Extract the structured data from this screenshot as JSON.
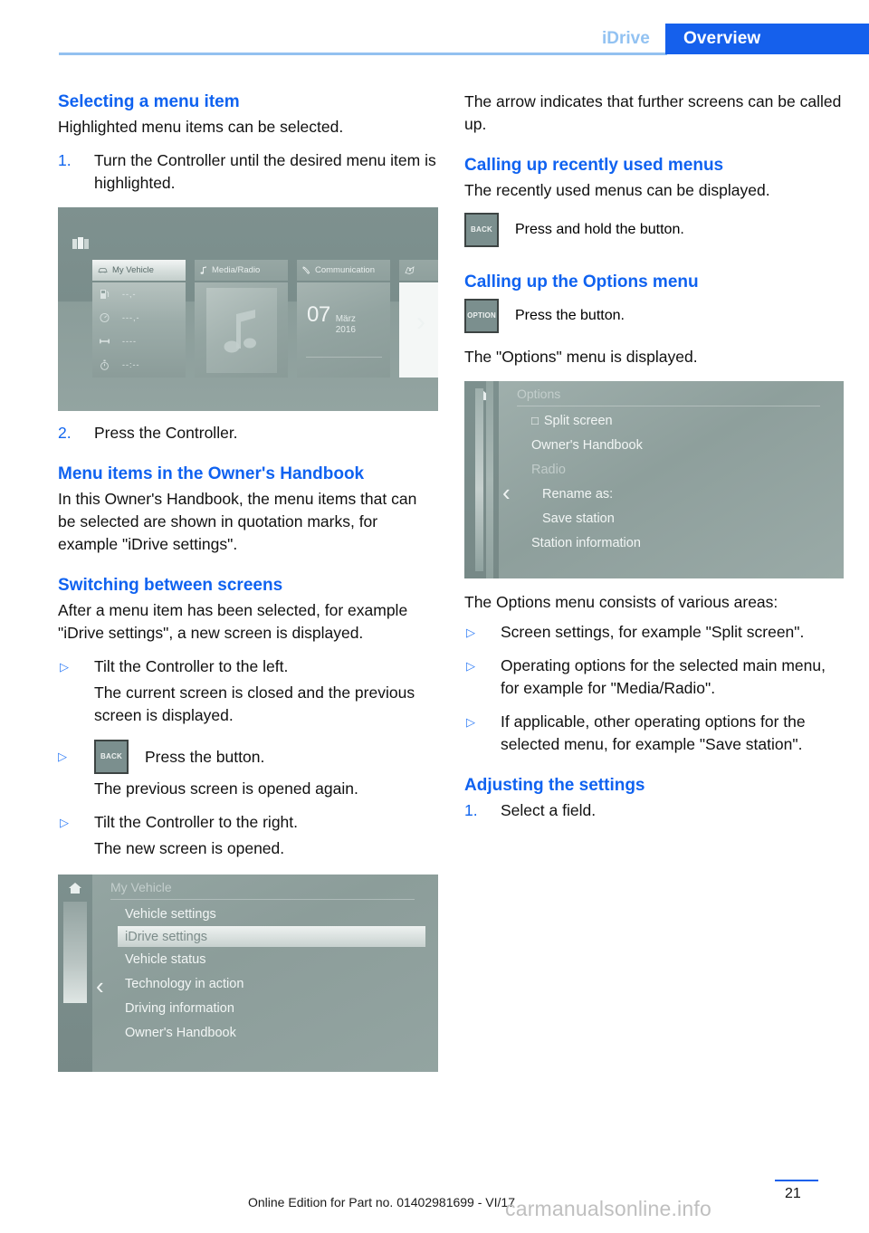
{
  "header": {
    "section": "iDrive",
    "tab": "Overview"
  },
  "left_column": {
    "h1": "Selecting a menu item",
    "p1": "Highlighted menu items can be selected.",
    "step1_num": "1.",
    "step1_text": "Turn the Controller until the desired menu item is highlighted.",
    "step2_num": "2.",
    "step2_text": "Press the Controller.",
    "h2": "Menu items in the Owner's Handbook",
    "p2": "In this Owner's Handbook, the menu items that can be selected are shown in quotation marks, for example \"iDrive settings\".",
    "h3": "Switching between screens",
    "p3": "After a menu item has been selected, for example \"iDrive settings\", a new screen is displayed.",
    "b1_marker": "▷",
    "b1_text": "Tilt the Controller to the left.",
    "b1_result": "The current screen is closed and the previous screen is displayed.",
    "b2_marker": "▷",
    "b2_key": "BACK",
    "b2_text": "Press the button.",
    "b2_result": "The previous screen is opened again.",
    "b3_marker": "▷",
    "b3_text": "Tilt the Controller to the right.",
    "b3_result": "The new screen is opened."
  },
  "right_column": {
    "p1": "The arrow indicates that further screens can be called up.",
    "h1": "Calling up recently used menus",
    "p2": "The recently used menus can be displayed.",
    "key_back": "BACK",
    "key_back_text": "Press and hold the button.",
    "h2": "Calling up the Options menu",
    "key_option": "OPTION",
    "key_option_text": "Press the button.",
    "p3": "The \"Options\" menu is displayed.",
    "p4": "The Options menu consists of various areas:",
    "b1_marker": "▷",
    "b1_text": "Screen settings, for example \"Split screen\".",
    "b2_marker": "▷",
    "b2_text": "Operating options for the selected main menu, for example for \"Media/Radio\".",
    "b3_marker": "▷",
    "b3_text": "If applicable, other operating options for the selected menu, for example \"Save station\".",
    "h3": "Adjusting the settings",
    "step1_num": "1.",
    "step1_text": "Select a field."
  },
  "screenshot_main_menu": {
    "tiles": [
      {
        "label": "My Vehicle",
        "icon": "car-icon",
        "active": true,
        "rows": [
          {
            "icon": "fuel-icon",
            "value": "--,-"
          },
          {
            "icon": "speedometer-icon",
            "value": "---,-"
          },
          {
            "icon": "distance-icon",
            "value": "----"
          },
          {
            "icon": "stopwatch-icon",
            "value": "--:--"
          }
        ]
      },
      {
        "label": "Media/Radio",
        "icon": "music-note-icon",
        "active": false
      },
      {
        "label": "Communication",
        "icon": "phone-icon",
        "active": false,
        "day": "07",
        "month": "März",
        "year": "2016"
      },
      {
        "label": "",
        "icon": "navigation-icon",
        "active": false
      }
    ],
    "next_arrow": "›"
  },
  "screenshot_my_vehicle": {
    "title": "My Vehicle",
    "home_icon": "home-icon",
    "back_chevron": "‹",
    "items": [
      {
        "label": "Vehicle settings",
        "selected": false
      },
      {
        "label": "iDrive settings",
        "selected": true
      },
      {
        "label": "Vehicle status",
        "selected": false
      },
      {
        "label": "Technology in action",
        "selected": false
      },
      {
        "label": "Driving information",
        "selected": false
      },
      {
        "label": "Owner's Handbook",
        "selected": false
      }
    ]
  },
  "screenshot_options": {
    "title": "Options",
    "home_icon": "home-icon",
    "back_chevron": "‹",
    "checkbox_glyph": "□",
    "items": [
      {
        "label": "Split screen",
        "checkbox": true,
        "indent": false,
        "muted": false
      },
      {
        "label": "Owner's Handbook",
        "checkbox": false,
        "indent": false,
        "muted": false
      },
      {
        "label": "Radio",
        "checkbox": false,
        "indent": false,
        "muted": true
      },
      {
        "label": "Rename as:",
        "checkbox": false,
        "indent": true,
        "muted": false
      },
      {
        "label": "Save station",
        "checkbox": false,
        "indent": true,
        "muted": false
      },
      {
        "label": "Station information",
        "checkbox": false,
        "indent": false,
        "muted": false
      }
    ]
  },
  "footer": {
    "edition": "Online Edition for Part no. 01402981699 - VI/17",
    "page_number": "21",
    "watermark": "carmanualsonline.info"
  }
}
